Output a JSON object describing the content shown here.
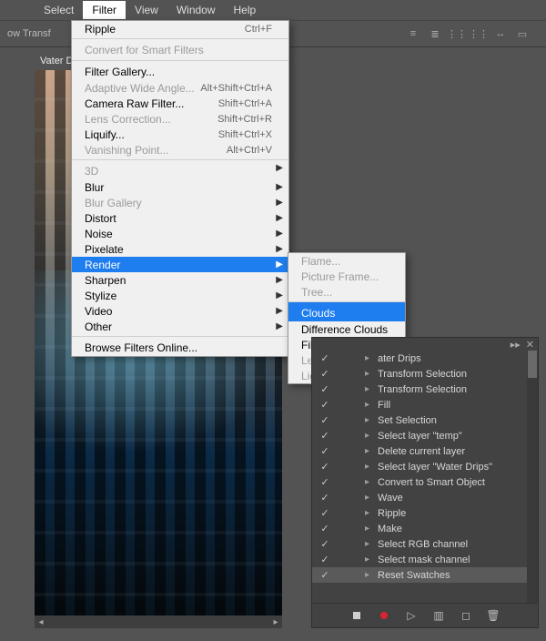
{
  "menubar": [
    "Select",
    "Filter",
    "View",
    "Window",
    "Help"
  ],
  "menubar_active_index": 1,
  "optbar_text": "ow Transf",
  "doc_tab": "Vater Dri",
  "filter_menu": [
    {
      "label": "Ripple",
      "shortcut": "Ctrl+F",
      "section": false
    },
    {
      "label": "Convert for Smart Filters",
      "section": true,
      "disabled": true
    },
    {
      "label": "Filter Gallery...",
      "section": true
    },
    {
      "label": "Adaptive Wide Angle...",
      "shortcut": "Alt+Shift+Ctrl+A",
      "disabled": true
    },
    {
      "label": "Camera Raw Filter...",
      "shortcut": "Shift+Ctrl+A"
    },
    {
      "label": "Lens Correction...",
      "shortcut": "Shift+Ctrl+R",
      "disabled": true
    },
    {
      "label": "Liquify...",
      "shortcut": "Shift+Ctrl+X"
    },
    {
      "label": "Vanishing Point...",
      "shortcut": "Alt+Ctrl+V",
      "disabled": true
    },
    {
      "label": "3D",
      "section": true,
      "arrow": true,
      "disabled": true
    },
    {
      "label": "Blur",
      "arrow": true
    },
    {
      "label": "Blur Gallery",
      "arrow": true,
      "disabled": true
    },
    {
      "label": "Distort",
      "arrow": true
    },
    {
      "label": "Noise",
      "arrow": true
    },
    {
      "label": "Pixelate",
      "arrow": true
    },
    {
      "label": "Render",
      "arrow": true,
      "highlight": true
    },
    {
      "label": "Sharpen",
      "arrow": true
    },
    {
      "label": "Stylize",
      "arrow": true
    },
    {
      "label": "Video",
      "arrow": true
    },
    {
      "label": "Other",
      "arrow": true
    },
    {
      "label": "Browse Filters Online...",
      "section": true
    }
  ],
  "render_submenu": [
    {
      "label": "Flame...",
      "disabled": true
    },
    {
      "label": "Picture Frame...",
      "disabled": true
    },
    {
      "label": "Tree...",
      "disabled": true
    },
    {
      "label": "Clouds",
      "section": true,
      "highlight": true
    },
    {
      "label": "Difference Clouds"
    },
    {
      "label": "Fibers..."
    },
    {
      "label": "Lens Flare...",
      "disabled": true
    },
    {
      "label": "Lighting Effects...",
      "disabled": true
    }
  ],
  "actions": [
    {
      "label": "ater Drips",
      "exp": true,
      "cut": true
    },
    {
      "label": "Transform Selection",
      "exp": true
    },
    {
      "label": "Transform Selection",
      "exp": true
    },
    {
      "label": "Fill",
      "exp": true
    },
    {
      "label": "Set Selection",
      "exp": true
    },
    {
      "label": "Select layer \"temp\"",
      "exp": true
    },
    {
      "label": "Delete current layer",
      "exp": true
    },
    {
      "label": "Select layer \"Water Drips\"",
      "exp": true
    },
    {
      "label": "Convert to Smart Object",
      "exp": true
    },
    {
      "label": "Wave",
      "exp": true
    },
    {
      "label": "Ripple",
      "exp": true
    },
    {
      "label": "Make",
      "exp": true
    },
    {
      "label": "Select RGB channel",
      "exp": true
    },
    {
      "label": "Select mask channel",
      "exp": true
    },
    {
      "label": "Reset Swatches",
      "exp": true,
      "sel": true
    }
  ],
  "panel_hdr": {
    "collapse": "▸▸",
    "close": "✕"
  }
}
